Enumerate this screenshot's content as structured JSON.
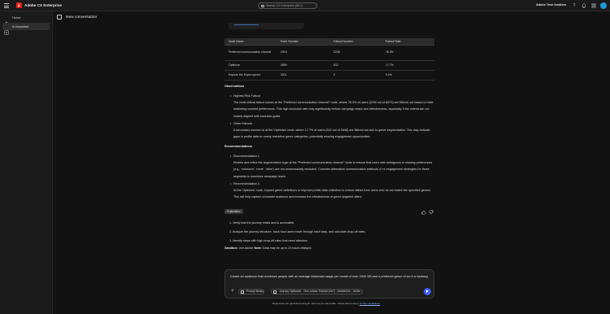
{
  "app": {
    "name": "Adobe CX Enterprise",
    "org": "Adobe Tech Insiders"
  },
  "search": {
    "placeholder": "Search CX Enterprise (⌘+/)"
  },
  "sidebar": {
    "items": [
      {
        "label": "Home",
        "icon": "home-icon"
      },
      {
        "label": "AI Assistant",
        "icon": "ai-assistant-icon"
      }
    ]
  },
  "conversation": {
    "title": "New conversation"
  },
  "table": {
    "headers": [
      "Node Name",
      "Enter Number",
      "Fallout Number",
      "Fallout Rate"
    ],
    "rows": [
      [
        "Preferred communication channel",
        "2919",
        "2236",
        "76.3%"
      ],
      [
        "Optimize",
        "2895",
        "512",
        "17.7%"
      ],
      [
        "Explore the Super-speed",
        "3311",
        "0",
        "0.0%"
      ]
    ]
  },
  "observations": {
    "heading": "Observations",
    "items": [
      {
        "title": "Highest Risk Fallout",
        "text": "The most critical fallout occurs at the \"Preferred communication channel\" node, where 76.3% of users (2236 out of 8679) are filtered out based on their marketing consent preferences. This high exclusion rate may significantly reduce campaign reach and effectiveness, especially if the criteria are not closely aligned with business goals."
      },
      {
        "title": "Other Fallouts",
        "text": "A secondary concern is at the 'Optimize' node, where 17.7% of users (512 out of 5448) are filtered out due to genre segmentation. This may indicate gaps in profile data or overly restrictive genre categories, potentially missing engagement opportunities."
      }
    ]
  },
  "recommendations": {
    "heading": "Recommendations",
    "items": [
      {
        "title": "Recommendation 1",
        "text": "Review and refine the segmentation logic at the \"Preferred communication channel\" node to ensure that users with ambiguous or missing preferences (e.g., 'unknown', 'none', 'other') are not unnecessarily excluded. Consider alternative communication methods or re-engagement strategies for these segments to maximize campaign reach."
      },
      {
        "title": "Recommendation 2",
        "text": "At the 'Optimize' node, expand genre definitions or improve profile data collection to reduce fallout from users who do not match the specified genres. This will help capture a broader audience and increase the effectiveness of genre-targeted offers."
      }
    ]
  },
  "explanation": {
    "badge": "Explanation",
    "steps": [
      "1. Verify that the journey exists and is accessible.",
      "2. Analyze the journey structure, track how users move through each step, and calculate drop-off rates.",
      "3. Identify steps with high drop-off rates that need attention."
    ],
    "sandbox_label": "Sandbox:",
    "sandbox_value": "one-adobe",
    "note_label": "Note:",
    "note_value": "Data may be up to 24 hours delayed."
  },
  "composer": {
    "text": "Create an audience that combines people with an average download usage per month of over 2000 GB and a preferred genre of sci-fi or fantasy|",
    "chips": [
      {
        "label": "Prompt library",
        "icon": "library-icon"
      },
      {
        "label": "Journey Optimizer - One Adobe Tutorial (VA7) - AdobeOne - Unifie...",
        "icon": "context-icon"
      }
    ]
  },
  "footer": {
    "disclaimer": "Responses are generated using AI, and may be inaccurate. Check before using.",
    "link": "AI User Guidelines"
  },
  "colors": {
    "accent": "#3b63fb",
    "brand": "#e8201e",
    "avatar": "#1a9bd8"
  }
}
